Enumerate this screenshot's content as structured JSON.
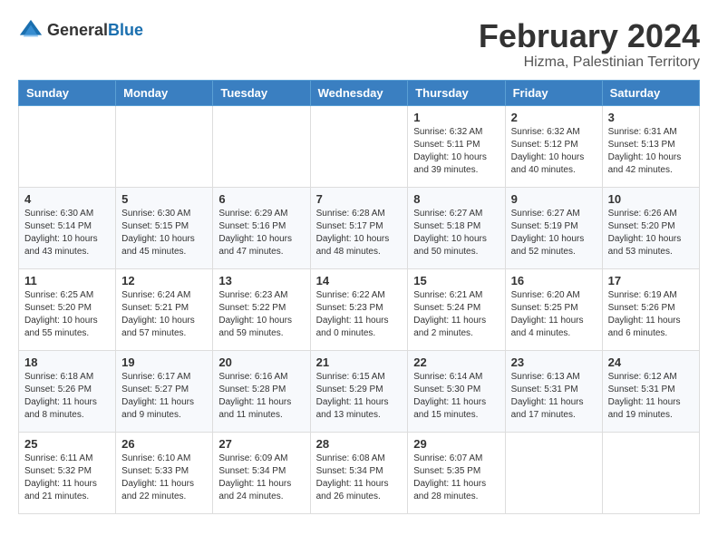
{
  "header": {
    "logo_general": "General",
    "logo_blue": "Blue",
    "month_year": "February 2024",
    "location": "Hizma, Palestinian Territory"
  },
  "weekdays": [
    "Sunday",
    "Monday",
    "Tuesday",
    "Wednesday",
    "Thursday",
    "Friday",
    "Saturday"
  ],
  "weeks": [
    [
      {
        "day": "",
        "info": ""
      },
      {
        "day": "",
        "info": ""
      },
      {
        "day": "",
        "info": ""
      },
      {
        "day": "",
        "info": ""
      },
      {
        "day": "1",
        "info": "Sunrise: 6:32 AM\nSunset: 5:11 PM\nDaylight: 10 hours and 39 minutes."
      },
      {
        "day": "2",
        "info": "Sunrise: 6:32 AM\nSunset: 5:12 PM\nDaylight: 10 hours and 40 minutes."
      },
      {
        "day": "3",
        "info": "Sunrise: 6:31 AM\nSunset: 5:13 PM\nDaylight: 10 hours and 42 minutes."
      }
    ],
    [
      {
        "day": "4",
        "info": "Sunrise: 6:30 AM\nSunset: 5:14 PM\nDaylight: 10 hours and 43 minutes."
      },
      {
        "day": "5",
        "info": "Sunrise: 6:30 AM\nSunset: 5:15 PM\nDaylight: 10 hours and 45 minutes."
      },
      {
        "day": "6",
        "info": "Sunrise: 6:29 AM\nSunset: 5:16 PM\nDaylight: 10 hours and 47 minutes."
      },
      {
        "day": "7",
        "info": "Sunrise: 6:28 AM\nSunset: 5:17 PM\nDaylight: 10 hours and 48 minutes."
      },
      {
        "day": "8",
        "info": "Sunrise: 6:27 AM\nSunset: 5:18 PM\nDaylight: 10 hours and 50 minutes."
      },
      {
        "day": "9",
        "info": "Sunrise: 6:27 AM\nSunset: 5:19 PM\nDaylight: 10 hours and 52 minutes."
      },
      {
        "day": "10",
        "info": "Sunrise: 6:26 AM\nSunset: 5:20 PM\nDaylight: 10 hours and 53 minutes."
      }
    ],
    [
      {
        "day": "11",
        "info": "Sunrise: 6:25 AM\nSunset: 5:20 PM\nDaylight: 10 hours and 55 minutes."
      },
      {
        "day": "12",
        "info": "Sunrise: 6:24 AM\nSunset: 5:21 PM\nDaylight: 10 hours and 57 minutes."
      },
      {
        "day": "13",
        "info": "Sunrise: 6:23 AM\nSunset: 5:22 PM\nDaylight: 10 hours and 59 minutes."
      },
      {
        "day": "14",
        "info": "Sunrise: 6:22 AM\nSunset: 5:23 PM\nDaylight: 11 hours and 0 minutes."
      },
      {
        "day": "15",
        "info": "Sunrise: 6:21 AM\nSunset: 5:24 PM\nDaylight: 11 hours and 2 minutes."
      },
      {
        "day": "16",
        "info": "Sunrise: 6:20 AM\nSunset: 5:25 PM\nDaylight: 11 hours and 4 minutes."
      },
      {
        "day": "17",
        "info": "Sunrise: 6:19 AM\nSunset: 5:26 PM\nDaylight: 11 hours and 6 minutes."
      }
    ],
    [
      {
        "day": "18",
        "info": "Sunrise: 6:18 AM\nSunset: 5:26 PM\nDaylight: 11 hours and 8 minutes."
      },
      {
        "day": "19",
        "info": "Sunrise: 6:17 AM\nSunset: 5:27 PM\nDaylight: 11 hours and 9 minutes."
      },
      {
        "day": "20",
        "info": "Sunrise: 6:16 AM\nSunset: 5:28 PM\nDaylight: 11 hours and 11 minutes."
      },
      {
        "day": "21",
        "info": "Sunrise: 6:15 AM\nSunset: 5:29 PM\nDaylight: 11 hours and 13 minutes."
      },
      {
        "day": "22",
        "info": "Sunrise: 6:14 AM\nSunset: 5:30 PM\nDaylight: 11 hours and 15 minutes."
      },
      {
        "day": "23",
        "info": "Sunrise: 6:13 AM\nSunset: 5:31 PM\nDaylight: 11 hours and 17 minutes."
      },
      {
        "day": "24",
        "info": "Sunrise: 6:12 AM\nSunset: 5:31 PM\nDaylight: 11 hours and 19 minutes."
      }
    ],
    [
      {
        "day": "25",
        "info": "Sunrise: 6:11 AM\nSunset: 5:32 PM\nDaylight: 11 hours and 21 minutes."
      },
      {
        "day": "26",
        "info": "Sunrise: 6:10 AM\nSunset: 5:33 PM\nDaylight: 11 hours and 22 minutes."
      },
      {
        "day": "27",
        "info": "Sunrise: 6:09 AM\nSunset: 5:34 PM\nDaylight: 11 hours and 24 minutes."
      },
      {
        "day": "28",
        "info": "Sunrise: 6:08 AM\nSunset: 5:34 PM\nDaylight: 11 hours and 26 minutes."
      },
      {
        "day": "29",
        "info": "Sunrise: 6:07 AM\nSunset: 5:35 PM\nDaylight: 11 hours and 28 minutes."
      },
      {
        "day": "",
        "info": ""
      },
      {
        "day": "",
        "info": ""
      }
    ]
  ]
}
